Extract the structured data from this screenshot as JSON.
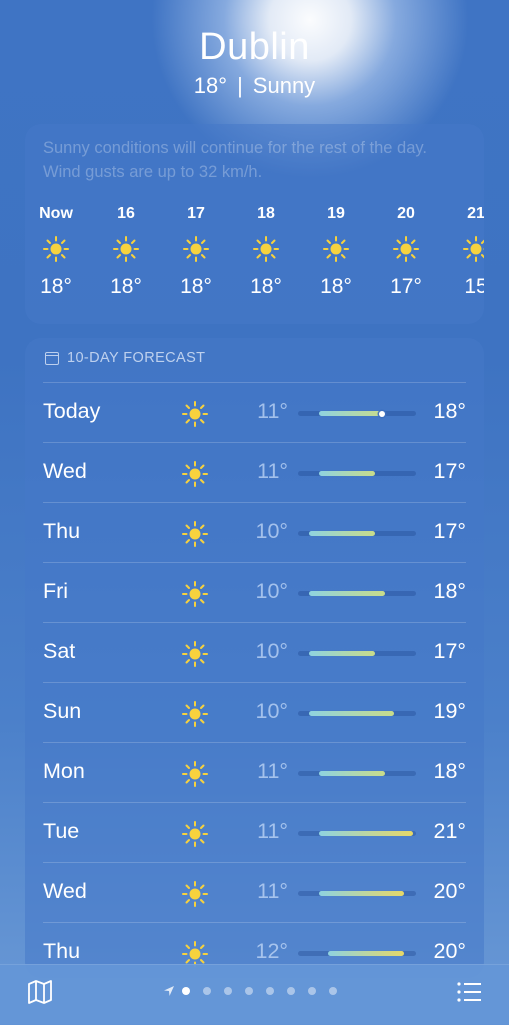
{
  "header": {
    "city": "Dublin",
    "temp": "18°",
    "separator": "|",
    "condition": "Sunny"
  },
  "hourly": {
    "description": "Sunny conditions will continue for the rest of the day. Wind gusts are up to 32 km/h.",
    "hours": [
      {
        "label": "Now",
        "icon": "sun-icon",
        "temp": "18°"
      },
      {
        "label": "16",
        "icon": "sun-icon",
        "temp": "18°"
      },
      {
        "label": "17",
        "icon": "sun-icon",
        "temp": "18°"
      },
      {
        "label": "18",
        "icon": "sun-icon",
        "temp": "18°"
      },
      {
        "label": "19",
        "icon": "sun-icon",
        "temp": "18°"
      },
      {
        "label": "20",
        "icon": "sun-icon",
        "temp": "17°"
      },
      {
        "label": "21",
        "icon": "sun-icon",
        "temp": "15"
      }
    ]
  },
  "forecast": {
    "title": "10-DAY FORECAST",
    "days": [
      {
        "day": "Today",
        "low": "11°",
        "high": "18°",
        "current": true
      },
      {
        "day": "Wed",
        "low": "11°",
        "high": "17°"
      },
      {
        "day": "Thu",
        "low": "10°",
        "high": "17°"
      },
      {
        "day": "Fri",
        "low": "10°",
        "high": "18°"
      },
      {
        "day": "Sat",
        "low": "10°",
        "high": "17°"
      },
      {
        "day": "Sun",
        "low": "10°",
        "high": "19°"
      },
      {
        "day": "Mon",
        "low": "11°",
        "high": "18°"
      },
      {
        "day": "Tue",
        "low": "11°",
        "high": "21°"
      },
      {
        "day": "Wed",
        "low": "11°",
        "high": "20°"
      },
      {
        "day": "Thu",
        "low": "12°",
        "high": "20°"
      }
    ]
  },
  "toolbar": {
    "pages": 8,
    "active_page": 0,
    "left_icon": "map-icon",
    "right_icon": "list-icon"
  },
  "colors": {
    "sun": "#F7D23E",
    "bar_cool": "#8FD3E0",
    "bar_warm": "#E6D868"
  }
}
